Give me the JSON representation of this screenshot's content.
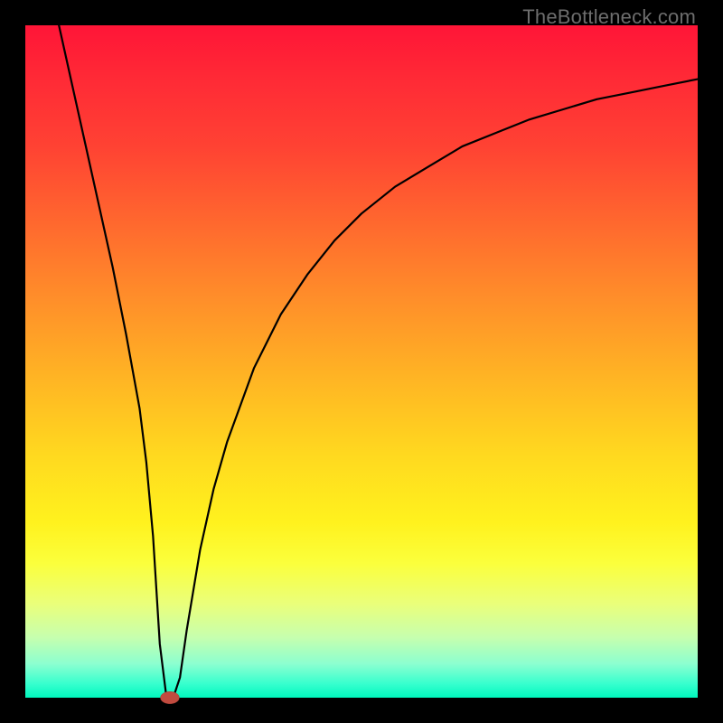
{
  "watermark": "TheBottleneck.com",
  "colors": {
    "frame": "#000000",
    "watermark": "#6d6d6d",
    "curve": "#000000",
    "marker_fill": "#c14b3f",
    "marker_stroke": "#a63e34"
  },
  "chart_data": {
    "type": "line",
    "title": "",
    "xlabel": "",
    "ylabel": "",
    "xlim": [
      0,
      100
    ],
    "ylim": [
      0,
      100
    ],
    "grid": false,
    "legend": false,
    "series": [
      {
        "name": "bottleneck-curve",
        "x": [
          5,
          7,
          9,
          11,
          13,
          15,
          17,
          18,
          19,
          20,
          21,
          22,
          23,
          24,
          26,
          28,
          30,
          34,
          38,
          42,
          46,
          50,
          55,
          60,
          65,
          70,
          75,
          80,
          85,
          90,
          95,
          100
        ],
        "y": [
          100,
          91,
          82,
          73,
          64,
          54,
          43,
          35,
          24,
          8,
          0,
          0,
          3,
          10,
          22,
          31,
          38,
          49,
          57,
          63,
          68,
          72,
          76,
          79,
          82,
          84,
          86,
          87.5,
          89,
          90,
          91,
          92
        ]
      }
    ],
    "marker": {
      "x": 21.5,
      "y": 0,
      "rx": 1.4,
      "ry": 0.9
    },
    "background_gradient": {
      "direction": "vertical",
      "stops": [
        {
          "pos": 0,
          "color": "#ff1537"
        },
        {
          "pos": 0.3,
          "color": "#ff6a2e"
        },
        {
          "pos": 0.55,
          "color": "#ffc022"
        },
        {
          "pos": 0.75,
          "color": "#fff21e"
        },
        {
          "pos": 0.9,
          "color": "#d5ff90"
        },
        {
          "pos": 1.0,
          "color": "#00f7bd"
        }
      ]
    }
  }
}
